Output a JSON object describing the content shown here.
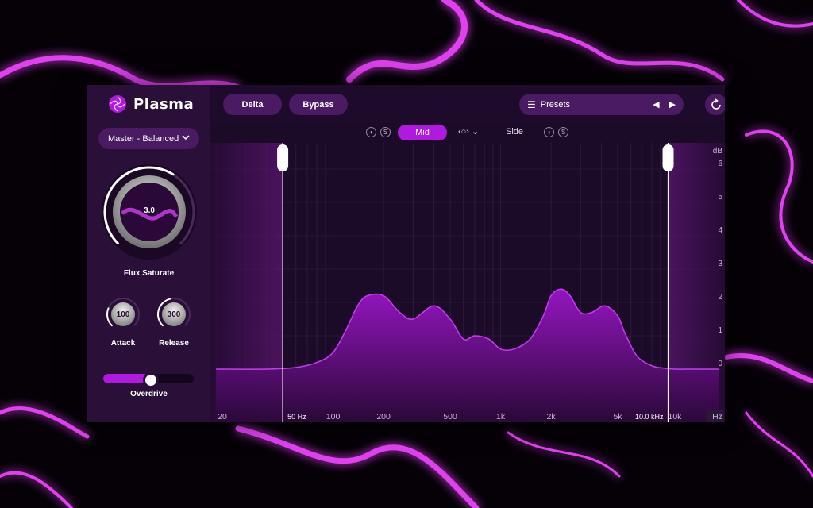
{
  "app": {
    "name": "Plasma"
  },
  "colors": {
    "accent": "#b01adf",
    "panel": "#2a1038",
    "button": "#4a1a63",
    "graph_bg": "#1b0a28"
  },
  "toolbar": {
    "delta_label": "Delta",
    "bypass_label": "Bypass",
    "presets_label": "Presets",
    "undo_icon": "refresh-icon",
    "settings_icon": "gear-icon",
    "help_label": "?"
  },
  "sidebar": {
    "preset_dropdown": "Master - Balanced",
    "main_knob": {
      "value": "3.0",
      "label": "Flux Saturate",
      "level": 0.62
    },
    "attack": {
      "value": "100",
      "label": "Attack",
      "level": 0.25
    },
    "release": {
      "value": "300",
      "label": "Release",
      "level": 0.45
    },
    "overdrive": {
      "label": "Overdrive",
      "level": 0.5
    }
  },
  "stereo": {
    "mid_label": "Mid",
    "side_label": "Side",
    "link_label": "‹○›",
    "solo_label": "S"
  },
  "graph": {
    "db_unit": "dB",
    "db_ticks": [
      "6",
      "5",
      "4",
      "3",
      "2",
      "1",
      "0"
    ],
    "freq_unit": "Hz",
    "freq_ticks": [
      "20",
      "100",
      "200",
      "500",
      "1k",
      "2k",
      "5k",
      "10k"
    ],
    "low_cut_label": "50 Hz",
    "high_cut_label": "10.0 kHz",
    "low_cut_hz": 50,
    "high_cut_hz": 10000
  },
  "curve": {
    "freq_hz": [
      20,
      40,
      60,
      80,
      100,
      120,
      140,
      160,
      200,
      250,
      300,
      400,
      500,
      600,
      700,
      850,
      1000,
      1200,
      1500,
      1800,
      2000,
      2300,
      2600,
      3000,
      3500,
      4200,
      5000,
      5500,
      6500,
      8000,
      9500,
      11000,
      14000,
      20000
    ],
    "db": [
      0,
      0,
      0.05,
      0.2,
      0.5,
      1.2,
      1.9,
      2.2,
      2.2,
      1.7,
      1.5,
      1.9,
      1.5,
      0.9,
      1.0,
      0.9,
      0.6,
      0.6,
      0.9,
      1.6,
      2.2,
      2.4,
      2.2,
      1.7,
      1.7,
      1.9,
      1.6,
      1.1,
      0.4,
      0.1,
      0.03,
      0,
      0,
      0
    ]
  }
}
